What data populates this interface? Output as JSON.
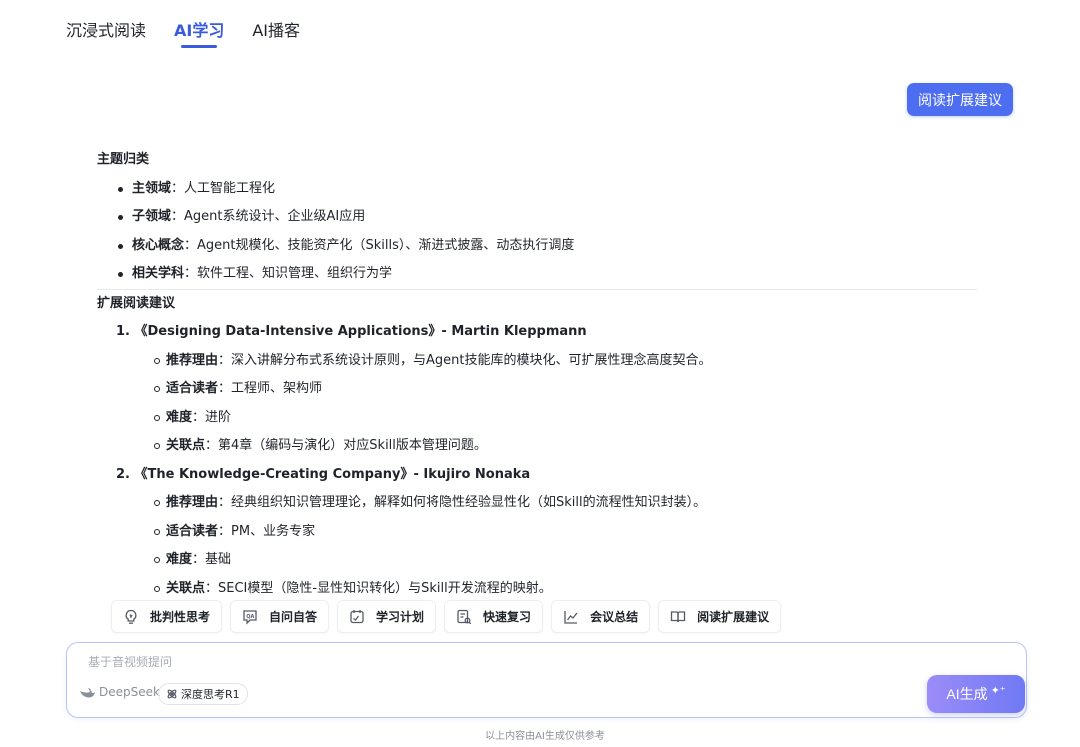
{
  "tabs": [
    "沉浸式阅读",
    "AI学习",
    "AI播客"
  ],
  "active_tab": "AI学习",
  "reading_button": "阅读扩展建议",
  "section1": {
    "title": "主题归类",
    "items": [
      {
        "key": "主领域",
        "value": "：人工智能工程化"
      },
      {
        "key": "子领域",
        "value": "：Agent系统设计、企业级AI应用"
      },
      {
        "key": "核心概念",
        "value": "：Agent规模化、技能资产化（Skills）、渐进式披露、动态执行调度"
      },
      {
        "key": "相关学科",
        "value": "：软件工程、知识管理、组织行为学"
      }
    ]
  },
  "section2": {
    "title": "扩展阅读建议",
    "books": [
      {
        "heading": "1. 《Designing Data-Intensive Applications》- Martin Kleppmann",
        "details": [
          {
            "key": "推荐理由",
            "value": "：深入讲解分布式系统设计原则，与Agent技能库的模块化、可扩展性理念高度契合。"
          },
          {
            "key": "适合读者",
            "value": "：工程师、架构师"
          },
          {
            "key": "难度",
            "value": "：进阶"
          },
          {
            "key": "关联点",
            "value": "：第4章（编码与演化）对应Skill版本管理问题。"
          }
        ]
      },
      {
        "heading": "2. 《The Knowledge-Creating Company》- Ikujiro Nonaka",
        "details": [
          {
            "key": "推荐理由",
            "value": "：经典组织知识管理理论，解释如何将隐性经验显性化（如Skill的流程性知识封装）。"
          },
          {
            "key": "适合读者",
            "value": "：PM、业务专家"
          },
          {
            "key": "难度",
            "value": "：基础"
          },
          {
            "key": "关联点",
            "value": "：SECI模型（隐性-显性知识转化）与Skill开发流程的映射。"
          }
        ]
      }
    ]
  },
  "chips": [
    {
      "label": "批判性思考",
      "icon": "bulb-icon"
    },
    {
      "label": "自问自答",
      "icon": "qa-icon"
    },
    {
      "label": "学习计划",
      "icon": "plan-icon"
    },
    {
      "label": "快速复习",
      "icon": "review-icon"
    },
    {
      "label": "会议总结",
      "icon": "chart-icon"
    },
    {
      "label": "阅读扩展建议",
      "icon": "book-icon"
    }
  ],
  "input": {
    "placeholder": "基于音视频提问",
    "model": "DeepSeek",
    "deep_think": "深度思考R1",
    "generate": "AI生成"
  },
  "footnote": "以上内容由AI生成仅供参考",
  "colors": {
    "accent": "#4e6ef2",
    "tab_active": "#3b5bdb"
  }
}
